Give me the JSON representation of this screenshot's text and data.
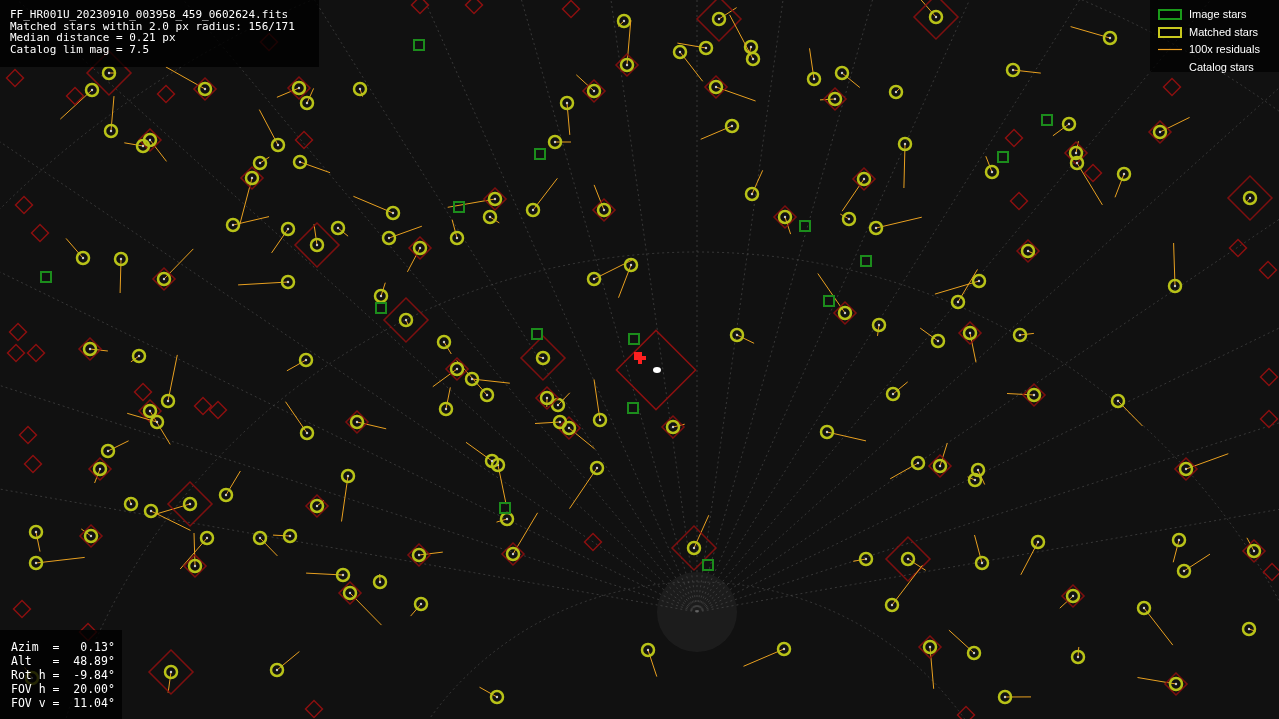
{
  "header_lines": [
    "FF_HR001U_20230910_003958_459_0602624.fits",
    "Matched stars within 2.0 px radius: 156/171",
    "Median distance = 0.21 px",
    "Catalog lim mag = 7.5"
  ],
  "pointing_lines": [
    "Azim  =   0.13°",
    "Alt   =  48.89°",
    "Rot h =  -9.84°",
    "FOV h =  20.00°",
    "FOV v =  11.04°"
  ],
  "legend": [
    {
      "kind": "image",
      "label": "Image stars"
    },
    {
      "kind": "matched",
      "label": "Matched stars"
    },
    {
      "kind": "residual",
      "label": "100x residuals"
    },
    {
      "kind": "catalog",
      "label": "Catalog stars"
    }
  ]
}
